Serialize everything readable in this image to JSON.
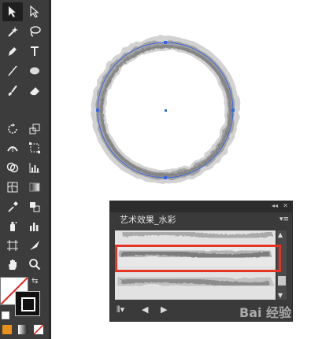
{
  "toolbar": {
    "tools": [
      {
        "name": "selection-tool",
        "icon": "arrow-icon"
      },
      {
        "name": "direct-selection-tool",
        "icon": "white-arrow-icon"
      },
      {
        "name": "magic-wand-tool",
        "icon": "magic-wand-icon"
      },
      {
        "name": "lasso-tool",
        "icon": "lasso-icon"
      },
      {
        "name": "pen-tool",
        "icon": "pen-icon"
      },
      {
        "name": "type-tool",
        "icon": "type-icon"
      },
      {
        "name": "line-tool",
        "icon": "line-icon"
      },
      {
        "name": "ellipse-tool",
        "icon": "ellipse-icon"
      },
      {
        "name": "paintbrush-tool",
        "icon": "brush-icon"
      },
      {
        "name": "eraser-tool",
        "icon": "eraser-icon"
      },
      {
        "name": "rotate-tool",
        "icon": "rotate-icon"
      },
      {
        "name": "scale-tool",
        "icon": "scale-icon"
      },
      {
        "name": "width-tool",
        "icon": "width-icon"
      },
      {
        "name": "free-transform-tool",
        "icon": "free-transform-icon"
      },
      {
        "name": "shape-builder-tool",
        "icon": "shape-builder-icon"
      },
      {
        "name": "graph-tool",
        "icon": "graph-icon"
      },
      {
        "name": "mesh-tool",
        "icon": "mesh-icon"
      },
      {
        "name": "gradient-tool",
        "icon": "gradient-icon"
      },
      {
        "name": "eyedropper-tool",
        "icon": "eyedropper-icon"
      },
      {
        "name": "blend-tool",
        "icon": "blend-icon"
      },
      {
        "name": "symbol-sprayer-tool",
        "icon": "symbol-sprayer-icon"
      },
      {
        "name": "column-graph-tool",
        "icon": "column-graph-icon"
      },
      {
        "name": "artboard-tool",
        "icon": "artboard-icon"
      },
      {
        "name": "slice-tool",
        "icon": "slice-icon"
      },
      {
        "name": "hand-tool",
        "icon": "hand-icon"
      },
      {
        "name": "zoom-tool",
        "icon": "zoom-icon"
      }
    ],
    "fill_stroke": {
      "fill": "none",
      "stroke": "#111111"
    }
  },
  "panel": {
    "tab_label": "艺术效果_水彩",
    "collapse_label": "◂◂",
    "close_label": "✕",
    "menu_label": "▾≡",
    "brushes": [
      {
        "name": "watercolor-brush-1",
        "selected": false
      },
      {
        "name": "watercolor-brush-2",
        "selected": true
      },
      {
        "name": "watercolor-brush-3",
        "selected": false
      }
    ],
    "bottom": {
      "library_label": "⫴▾",
      "prev_label": "◀",
      "next_label": "▶"
    }
  },
  "colors": {
    "accent_path": "#3a66e0",
    "highlight": "#e53424",
    "panel_bg": "#3a3a3a"
  },
  "watermark": "Bai 经验"
}
